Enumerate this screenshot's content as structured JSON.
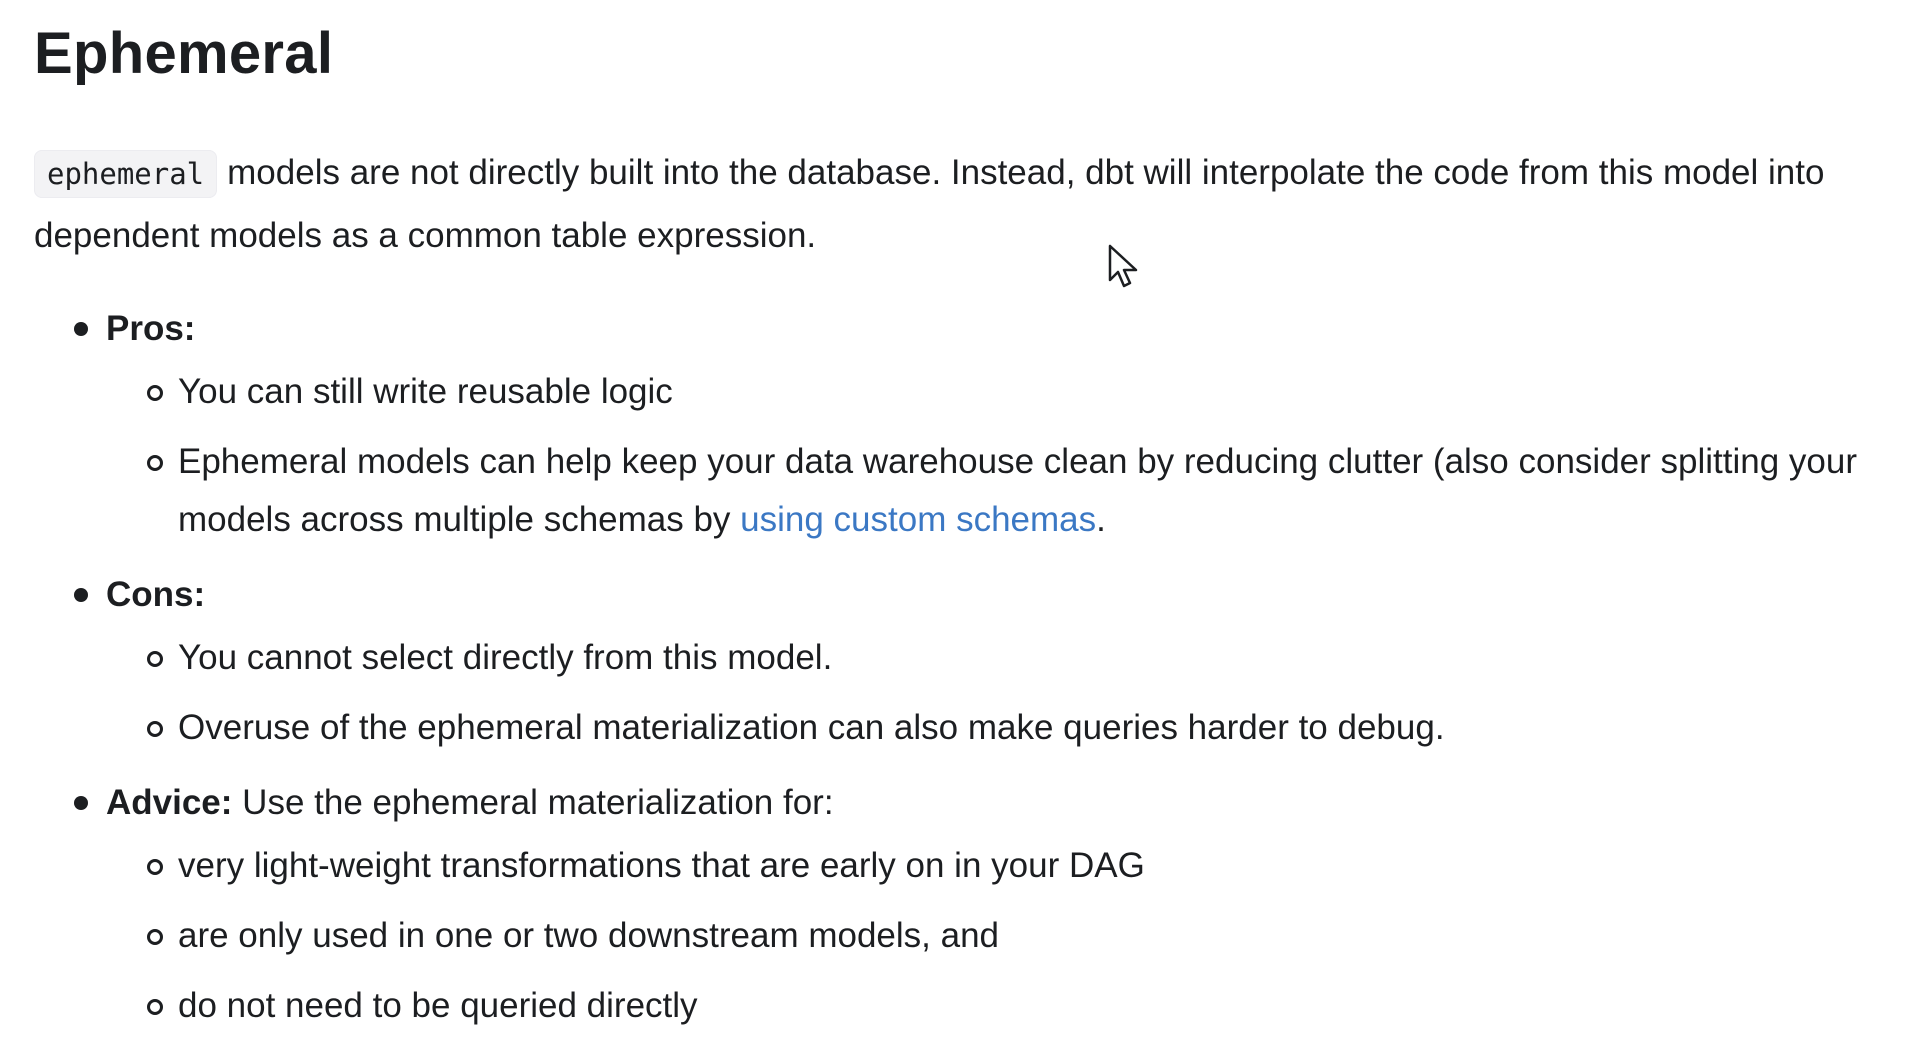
{
  "heading": "Ephemeral",
  "intro": {
    "code": "ephemeral",
    "text": "models are not directly built into the database. Instead, dbt will interpolate the code from this model into dependent models as a common table expression."
  },
  "pros": {
    "label": "Pros:",
    "items": [
      "You can still write reusable logic"
    ],
    "warehouse_item": {
      "text_before": "Ephemeral models can help keep your data warehouse clean by reducing clutter (also consider splitting your models across multiple schemas by ",
      "link_text": "using custom schemas",
      "text_after": "."
    }
  },
  "cons": {
    "label": "Cons:",
    "items": [
      "You cannot select directly from this model.",
      "Overuse of the ephemeral materialization can also make queries harder to debug."
    ]
  },
  "advice": {
    "label": "Advice:",
    "text": "Use the ephemeral materialization for:",
    "items": [
      "very light-weight transformations that are early on in your DAG",
      "are only used in one or two downstream models, and",
      "do not need to be queried directly"
    ]
  },
  "colors": {
    "text": "#1c1e21",
    "link": "#3b78c4",
    "code_bg": "#f3f3f5"
  },
  "icons": {
    "cursor": "mouse-pointer-icon"
  }
}
